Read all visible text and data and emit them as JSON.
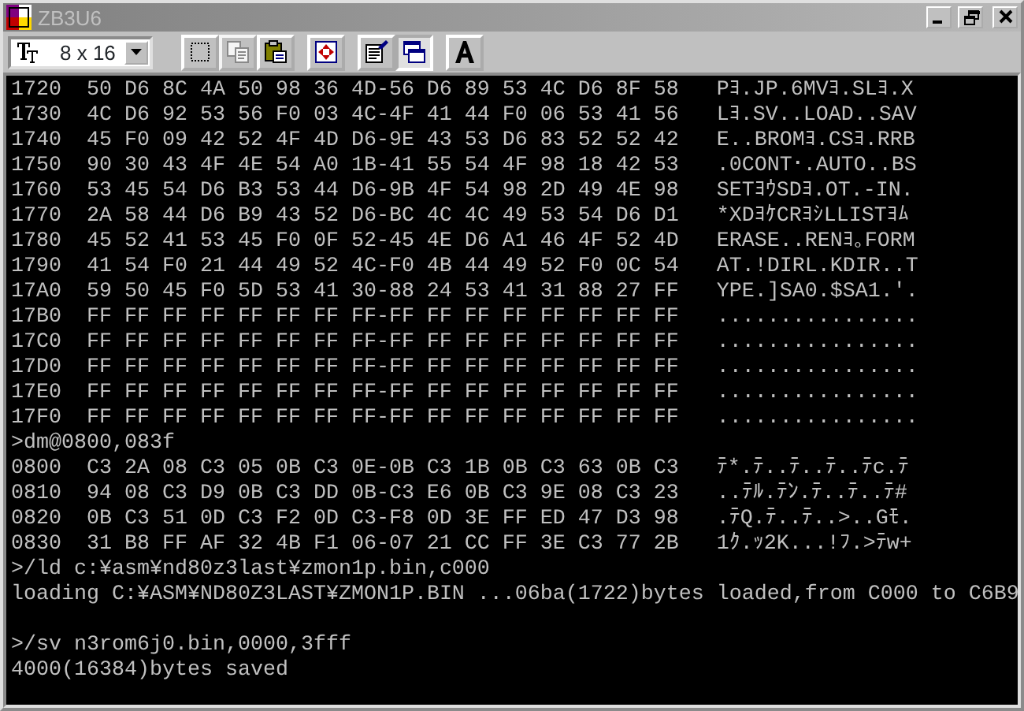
{
  "window": {
    "title": "ZB3U6",
    "active": false
  },
  "toolbar": {
    "font_size": "8 x 16",
    "buttons": [
      {
        "kind": "mark",
        "disabled": false,
        "selected": false
      },
      {
        "kind": "copy",
        "disabled": true,
        "selected": false
      },
      {
        "kind": "paste",
        "disabled": false,
        "selected": false
      },
      {
        "kind": "fullscreen",
        "disabled": false,
        "selected": false
      },
      {
        "kind": "properties",
        "disabled": false,
        "selected": false
      },
      {
        "kind": "background",
        "disabled": false,
        "selected": true
      },
      {
        "kind": "font",
        "disabled": false,
        "selected": false
      }
    ]
  },
  "console": {
    "lines": [
      {
        "kind": "dump",
        "address": "1720",
        "bytes": "50 D6 8C 4A 50 98 36 4D-56 D6 89 53 4C D6 8F 58",
        "ascii": "Pﾖ.JP.6MVﾖ.SLﾖ.X"
      },
      {
        "kind": "dump",
        "address": "1730",
        "bytes": "4C D6 92 53 56 F0 03 4C-4F 41 44 F0 06 53 41 56",
        "ascii": "Lﾖ.SV..LOAD..SAV"
      },
      {
        "kind": "dump",
        "address": "1740",
        "bytes": "45 F0 09 42 52 4F 4D D6-9E 43 53 D6 83 52 52 42",
        "ascii": "E..BROMﾖ.CSﾖ.RRB"
      },
      {
        "kind": "dump",
        "address": "1750",
        "bytes": "90 30 43 4F 4E 54 A0 1B-41 55 54 4F 98 18 42 53",
        "ascii": ".0CONT･.AUTO..BS"
      },
      {
        "kind": "dump",
        "address": "1760",
        "bytes": "53 45 54 D6 B3 53 44 D6-9B 4F 54 98 2D 49 4E 98",
        "ascii": "SETﾖｳSDﾖ.OT.-IN."
      },
      {
        "kind": "dump",
        "address": "1770",
        "bytes": "2A 58 44 D6 B9 43 52 D6-BC 4C 4C 49 53 54 D6 D1",
        "ascii": "*XDﾖｹCRﾖｼLLISTﾖﾑ"
      },
      {
        "kind": "dump",
        "address": "1780",
        "bytes": "45 52 41 53 45 F0 0F 52-45 4E D6 A1 46 4F 52 4D",
        "ascii": "ERASE..RENﾖ｡FORM"
      },
      {
        "kind": "dump",
        "address": "1790",
        "bytes": "41 54 F0 21 44 49 52 4C-F0 4B 44 49 52 F0 0C 54",
        "ascii": "AT.!DIRL.KDIR..T"
      },
      {
        "kind": "dump",
        "address": "17A0",
        "bytes": "59 50 45 F0 5D 53 41 30-88 24 53 41 31 88 27 FF",
        "ascii": "YPE.]SA0.$SA1.'."
      },
      {
        "kind": "dump",
        "address": "17B0",
        "bytes": "FF FF FF FF FF FF FF FF-FF FF FF FF FF FF FF FF",
        "ascii": "................"
      },
      {
        "kind": "dump",
        "address": "17C0",
        "bytes": "FF FF FF FF FF FF FF FF-FF FF FF FF FF FF FF FF",
        "ascii": "................"
      },
      {
        "kind": "dump",
        "address": "17D0",
        "bytes": "FF FF FF FF FF FF FF FF-FF FF FF FF FF FF FF FF",
        "ascii": "................"
      },
      {
        "kind": "dump",
        "address": "17E0",
        "bytes": "FF FF FF FF FF FF FF FF-FF FF FF FF FF FF FF FF",
        "ascii": "................"
      },
      {
        "kind": "dump",
        "address": "17F0",
        "bytes": "FF FF FF FF FF FF FF FF-FF FF FF FF FF FF FF FF",
        "ascii": "................"
      },
      {
        "kind": "text",
        "text": ">dm@0800,083f"
      },
      {
        "kind": "dump",
        "address": "0800",
        "bytes": "C3 2A 08 C3 05 0B C3 0E-0B C3 1B 0B C3 63 0B C3",
        "ascii": "ﾃ*.ﾃ..ﾃ..ﾃ..ﾃc.ﾃ"
      },
      {
        "kind": "dump",
        "address": "0810",
        "bytes": "94 08 C3 D9 0B C3 DD 0B-C3 E6 0B C3 9E 08 C3 23",
        "ascii": "..ﾃﾙ.ﾃﾝ.ﾃ..ﾃ..ﾃ#"
      },
      {
        "kind": "dump",
        "address": "0820",
        "bytes": "0B C3 51 0D C3 F2 0D C3-F8 0D 3E FF ED 47 D3 98",
        "ascii": ".ﾃQ.ﾃ..ﾃ..>..Gﾓ."
      },
      {
        "kind": "dump",
        "address": "0830",
        "bytes": "31 B8 FF AF 32 4B F1 06-07 21 CC FF 3E C3 77 2B",
        "ascii": "1ｸ.ｯ2K...!ﾌ.>ﾃw+"
      },
      {
        "kind": "text",
        "text": ">/ld c:¥asm¥nd80z3last¥zmon1p.bin,c000"
      },
      {
        "kind": "text",
        "text": "loading C:¥ASM¥ND80Z3LAST¥ZMON1P.BIN ...06ba(1722)bytes loaded,from C000 to C6B9"
      },
      {
        "kind": "blank"
      },
      {
        "kind": "text",
        "text": ">/sv n3rom6j0.bin,0000,3fff"
      },
      {
        "kind": "text",
        "text": "4000(16384)bytes saved"
      }
    ]
  }
}
